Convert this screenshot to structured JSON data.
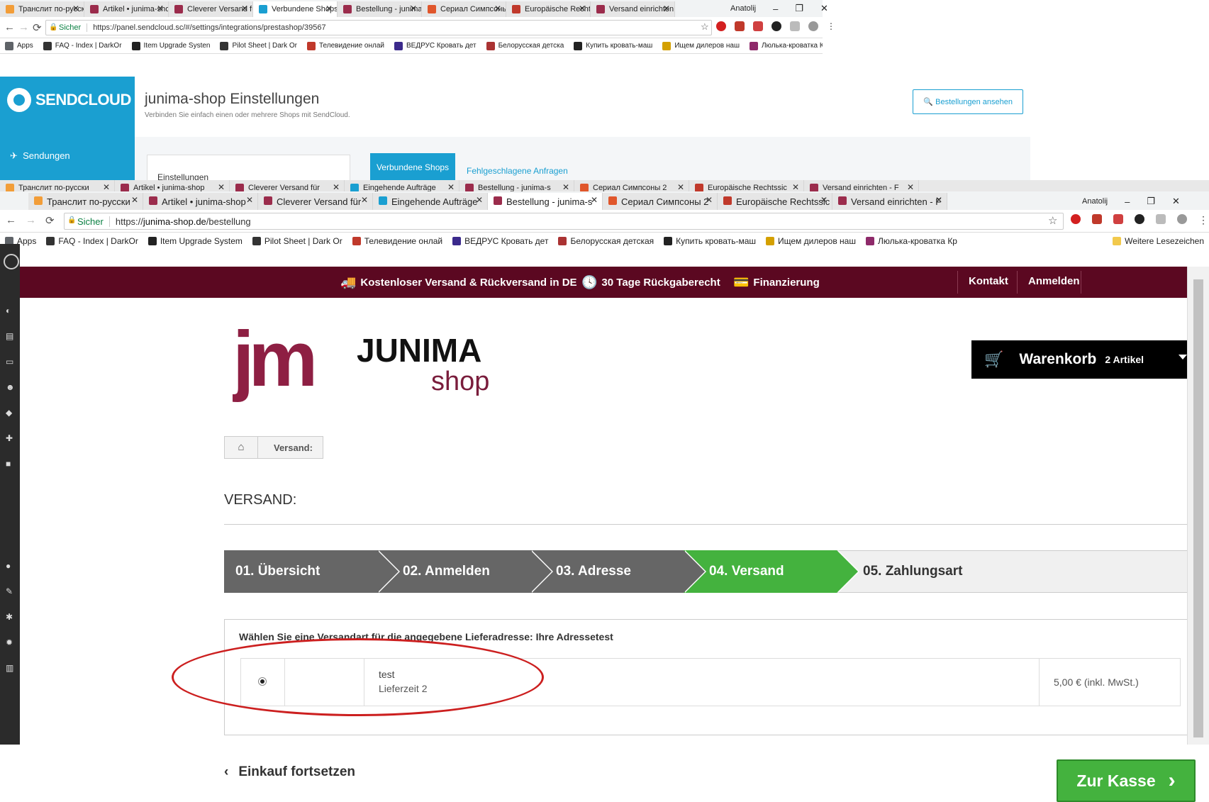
{
  "back_window": {
    "tabs": [
      {
        "label": "Транслит по-русски",
        "color": "#f29d38"
      },
      {
        "label": "Artikel • junima-shop",
        "color": "#9b2c4c"
      },
      {
        "label": "Cleverer Versand für",
        "color": "#9b2c4c"
      },
      {
        "label": "Verbundene Shops",
        "color": "#1a9fd1"
      },
      {
        "label": "Bestellung - junima-s",
        "color": "#9b2c4c"
      },
      {
        "label": "Сериал Симпсоны 2",
        "color": "#e0562b"
      },
      {
        "label": "Europäische Rechtssic",
        "color": "#c0392b"
      },
      {
        "label": "Versand einrichten - F",
        "color": "#9b2c4c"
      }
    ],
    "user": "Anatolij",
    "url_secure": "Sicher",
    "url": "https://panel.sendcloud.sc/#/settings/integrations/prestashop/39567",
    "bookmarks": [
      "Apps",
      "FAQ - Index | DarkOr",
      "Item Upgrade Systen",
      "Pilot Sheet | Dark Or",
      "Телевидение онлай",
      "ВЕДРУС Кровать дет",
      "Белорусская детска",
      "Купить кровать-маш",
      "Ищем дилеров наш",
      "Люлька-кроватка Кр"
    ],
    "more_bookmarks": "Weitere Lesezeichen",
    "brand": "SENDCLOUD",
    "nav_sendungen": "Sendungen",
    "page_title": "junima-shop Einstellungen",
    "page_subtitle": "Verbinden Sie einfach einen oder mehrere Shops mit SendCloud.",
    "orders_button": "Bestellungen ansehen",
    "settings_card": "Einstellungen",
    "tab_connected": "Verbundene Shops",
    "tab_failed": "Fehlgeschlagene Anfragen"
  },
  "front_window": {
    "tabs_row1": [
      "Транслит по-русски",
      "Artikel • junima-shop",
      "Cleverer Versand für",
      "Eingehende Aufträge",
      "Bestellung - junima-s",
      "Сериал Симпсоны 2",
      "Europäische Rechtssic",
      "Versand einrichten - F"
    ],
    "user": "Anatolij",
    "tabs": [
      {
        "label": "Транслит по-русски",
        "color": "#f29d38"
      },
      {
        "label": "Artikel • junima-shop",
        "color": "#9b2c4c"
      },
      {
        "label": "Cleverer Versand für",
        "color": "#9b2c4c"
      },
      {
        "label": "Eingehende Aufträge",
        "color": "#1a9fd1"
      },
      {
        "label": "Bestellung - junima-s",
        "color": "#9b2c4c",
        "active": true
      },
      {
        "label": "Сериал Симпсоны 2",
        "color": "#e0562b"
      },
      {
        "label": "Europäische Rechtssic",
        "color": "#c0392b"
      },
      {
        "label": "Versand einrichten - F",
        "color": "#9b2c4c"
      }
    ],
    "url_secure": "Sicher",
    "url_scheme": "https://",
    "url_host": "junima-shop.de",
    "url_path": "/bestellung",
    "bookmarks": [
      "Apps",
      "FAQ - Index | DarkOr",
      "Item Upgrade System",
      "Pilot Sheet | Dark Or",
      "Телевидение онлай",
      "ВЕДРУС Кровать дет",
      "Белорусская детская",
      "Купить кровать-маш",
      "Ищем дилеров наш",
      "Люлька-кроватка Кр"
    ],
    "more_bookmarks": "Weitere Lesezeichen"
  },
  "shop": {
    "colors": {
      "brand": "#5b0821",
      "accent": "#44b23e"
    },
    "topbar": {
      "free_shipping": "Kostenloser Versand & Rückversand in DE",
      "returns": "30 Tage Rückgaberecht",
      "financing": "Finanzierung",
      "contact": "Kontakt",
      "login": "Anmelden"
    },
    "logo": {
      "mark": "jm",
      "name": "JUNIMA",
      "sub": "shop"
    },
    "cart": {
      "label": "Warenkorb",
      "count": "2 Artikel"
    },
    "breadcrumb": {
      "current": "Versand:"
    },
    "heading": "VERSAND:",
    "steps": [
      {
        "label": "01. Übersicht",
        "state": "done"
      },
      {
        "label": "02. Anmelden",
        "state": "done"
      },
      {
        "label": "03. Adresse",
        "state": "done"
      },
      {
        "label": "04. Versand",
        "state": "active"
      },
      {
        "label": "05. Zahlungsart",
        "state": "next"
      }
    ],
    "shipping": {
      "prompt": "Wählen Sie eine Versandart für die angegebene Lieferadresse: Ihre Adressetest",
      "method_name": "test",
      "method_time": "Lieferzeit 2",
      "method_price": "5,00 € (inkl. MwSt.)"
    },
    "back_link": "Einkauf fortsetzen",
    "checkout_button": "Zur Kasse"
  }
}
